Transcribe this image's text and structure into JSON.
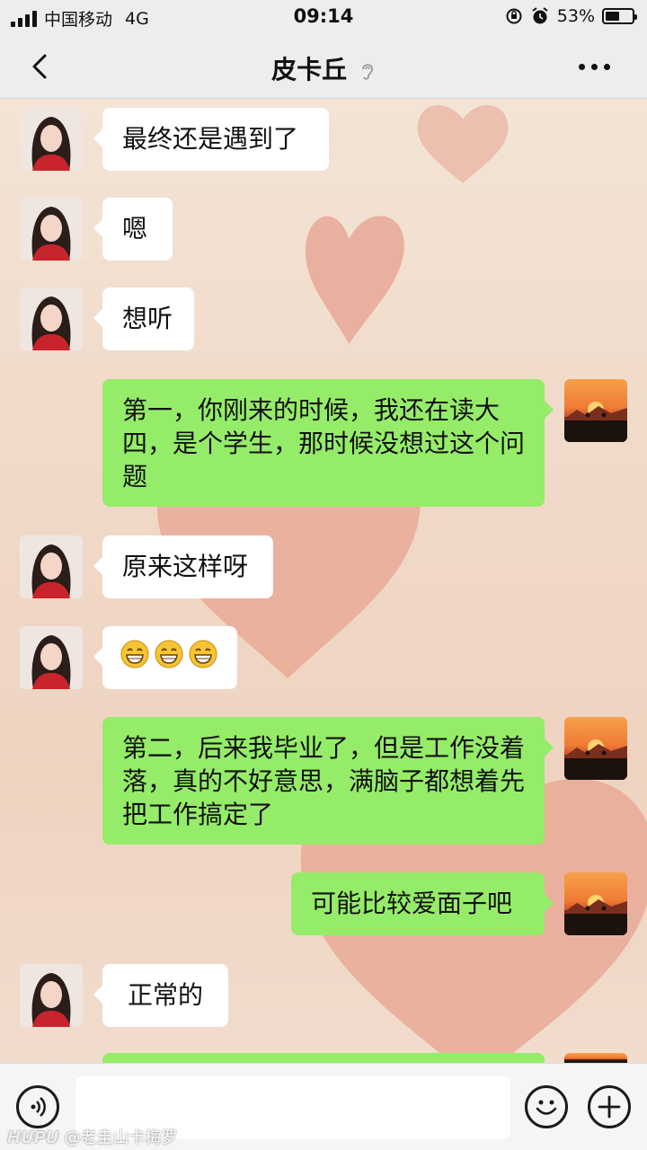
{
  "status_bar": {
    "carrier": "中国移动",
    "network": "4G",
    "time": "09:14",
    "battery_text": "53%",
    "battery_level": 0.53
  },
  "nav": {
    "title": "皮卡丘",
    "back_icon": "chevron-left-icon",
    "more_icon": "more-dots-icon",
    "ear_icon": "ear-icon"
  },
  "messages": [
    {
      "side": "left",
      "text": "最终还是遇到了"
    },
    {
      "side": "left",
      "text": "嗯"
    },
    {
      "side": "left",
      "text": "想听"
    },
    {
      "side": "right",
      "text": "第一，你刚来的时候，我还在读大四，是个学生，那时候没想过这个问题"
    },
    {
      "side": "left",
      "text": "原来这样呀"
    },
    {
      "side": "left",
      "text": "😁😁😁"
    },
    {
      "side": "right",
      "text": "第二，后来我毕业了，但是工作没着落，真的不好意思，满脑子都想着先把工作搞定了"
    },
    {
      "side": "right",
      "text": "可能比较爱面子吧"
    },
    {
      "side": "left",
      "text": "正常的"
    }
  ],
  "input_bar": {
    "voice_icon": "voice-icon",
    "emoji_icon": "emoji-icon",
    "plus_icon": "plus-icon",
    "text_value": ""
  },
  "watermark": {
    "brand": "HUPU",
    "text": "@老圭山卡梅罗"
  },
  "colors": {
    "my_bubble": "#95ec69",
    "their_bubble": "#ffffff",
    "bar_bg": "#ededed"
  }
}
